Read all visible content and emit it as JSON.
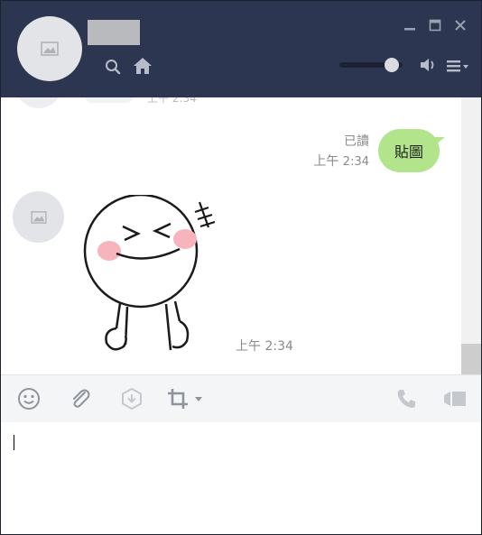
{
  "header": {
    "contact_name": "",
    "icons": [
      "search-icon",
      "home-icon",
      "speaker-icon",
      "menu-icon",
      "minimize-icon",
      "maximize-icon",
      "close-icon"
    ],
    "volume_level": 0.92
  },
  "chat": {
    "partial_message_time": "上午 2:34",
    "outgoing": {
      "text": "貼圖",
      "read_status": "已讀",
      "time_prefix": "上午",
      "time": "2:34"
    },
    "incoming": {
      "sticker_name": "sticker-image",
      "time": "上午 2:34"
    }
  },
  "toolbar": {
    "icons": [
      "emoji-icon",
      "attachment-icon",
      "download-icon",
      "crop-icon",
      "chevron-down-icon",
      "phone-icon",
      "video-call-icon"
    ]
  },
  "input": {
    "value": ""
  },
  "colors": {
    "header_bg": "#2c3650",
    "bubble_green": "#b2e58b",
    "avatar_bg": "#e3e4e8"
  }
}
